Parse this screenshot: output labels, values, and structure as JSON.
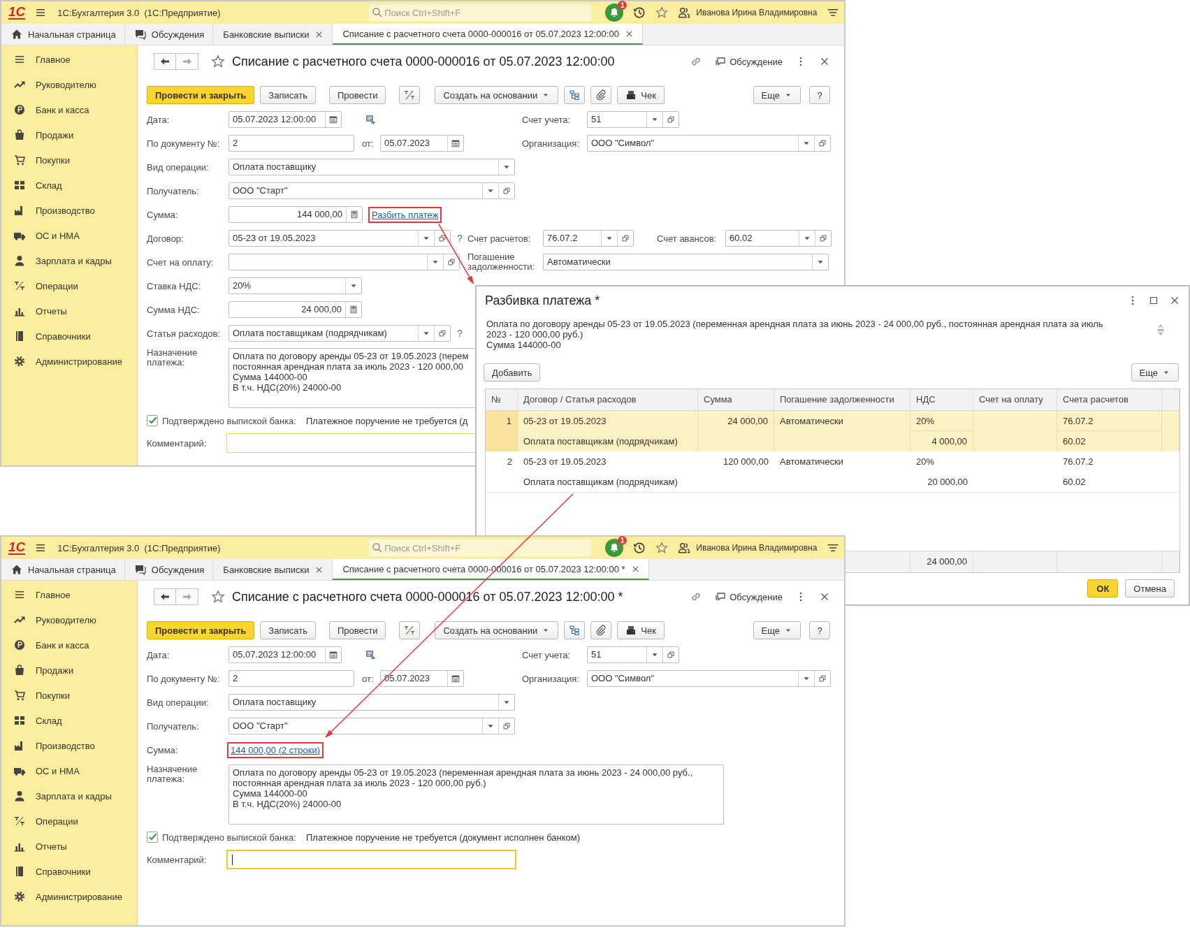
{
  "windows": [
    {
      "logo": "1С",
      "app_title": "1С:Бухгалтерия 3.0  (1С:Предприятие)",
      "search": {
        "placeholder": "Поиск Ctrl+Shift+F"
      },
      "notifications": "1",
      "user": "Иванова Ирина Владимировна",
      "tabs": [
        {
          "label": "Начальная страница",
          "selected": false,
          "kind": "home"
        },
        {
          "label": "Обсуждения",
          "selected": false,
          "kind": "chat"
        },
        {
          "label": "Банковские выписки",
          "selected": false,
          "kind": "doc"
        },
        {
          "label": "Списание с расчетного счета 0000-000016 от 05.07.2023 12:00:00",
          "selected": true,
          "kind": "doc"
        }
      ],
      "sidebar": [
        "Главное",
        "Руководителю",
        "Банк и касса",
        "Продажи",
        "Покупки",
        "Склад",
        "Производство",
        "ОС и НМА",
        "Зарплата и кадры",
        "Операции",
        "Отчеты",
        "Справочники",
        "Администрирование"
      ],
      "title": "Списание с расчетного счета 0000-000016 от 05.07.2023 12:00:00",
      "discussion": "Обсуждение",
      "toolbar": [
        {
          "kind": "primary",
          "label": "Провести и закрыть"
        },
        {
          "kind": "plain",
          "label": "Записать"
        },
        {
          "kind": "plain",
          "label": "Провести"
        },
        {
          "kind": "dtkt"
        },
        {
          "kind": "dropdown",
          "label": "Создать на основании"
        },
        {
          "kind": "structure"
        },
        {
          "kind": "clip"
        },
        {
          "kind": "receipt",
          "label": "Чек"
        }
      ],
      "toolbar_right": [
        {
          "kind": "dropdown",
          "label": "Еще"
        },
        {
          "kind": "plain",
          "label": "?"
        }
      ],
      "form": {
        "date": {
          "label": "Дата:",
          "value": "05.07.2023 12:00:00"
        },
        "number": {
          "label": "По документу №:",
          "value": "2"
        },
        "number_date": {
          "label": "от:",
          "value": "05.07.2023"
        },
        "account": {
          "label": "Счет учета:",
          "value": "51"
        },
        "organization": {
          "label": "Организация:",
          "value": "ООО \"Символ\""
        },
        "operation": {
          "label": "Вид операции:",
          "value": "Оплата поставщику"
        },
        "recipient": {
          "label": "Получатель:",
          "value": "ООО \"Старт\""
        },
        "amount": {
          "label": "Сумма:",
          "value": "144 000,00",
          "link": "Разбить платеж",
          "highlighted": true
        },
        "contract": {
          "label": "Договор:",
          "value": "05-23 от 19.05.2023",
          "help": "?"
        },
        "settlement_account": {
          "label": "Счет расчетов:",
          "value": "76.07.2"
        },
        "advance_account": {
          "label": "Счет авансов:",
          "value": "60.02"
        },
        "invoice": {
          "label": "Счет на оплату:"
        },
        "repayment": {
          "label": "Погашение задолженности:",
          "value": "Автоматически"
        },
        "vat_rate": {
          "label": "Ставка НДС:",
          "value": "20%"
        },
        "vat_amount": {
          "label": "Сумма НДС:",
          "value": "24 000,00"
        },
        "expense_item": {
          "label": "Статья расходов:",
          "value": "Оплата поставщикам (подрядчикам)",
          "help": "?"
        },
        "purpose": {
          "label": "Назначение платежа:",
          "text": "Оплата по договору аренды 05-23 от 19.05.2023 (перем\nпостоянная арендная плата за июль 2023 - 120 000,00\nСумма 144000-00\nВ т.ч. НДС(20%) 24000-00"
        },
        "confirmed": {
          "label": "Подтверждено выпиской банка:",
          "checked": true
        },
        "payment_order_note": "Платежное поручение не требуется (д",
        "comment": {
          "label": "Комментарий:",
          "focused": false
        }
      }
    },
    {
      "logo": "1С",
      "app_title": "1С:Бухгалтерия 3.0  (1С:Предприятие)",
      "search": {
        "placeholder": "Поиск Ctrl+Shift+F"
      },
      "notifications": "1",
      "user": "Иванова Ирина Владимировна",
      "tabs": [
        {
          "label": "Начальная страница",
          "selected": false,
          "kind": "home"
        },
        {
          "label": "Обсуждения",
          "selected": false,
          "kind": "chat"
        },
        {
          "label": "Банковские выписки",
          "selected": false,
          "kind": "doc"
        },
        {
          "label": "Списание с расчетного счета 0000-000016 от 05.07.2023 12:00:00 *",
          "selected": true,
          "kind": "doc"
        }
      ],
      "sidebar": [
        "Главное",
        "Руководителю",
        "Банк и касса",
        "Продажи",
        "Покупки",
        "Склад",
        "Производство",
        "ОС и НМА",
        "Зарплата и кадры",
        "Операции",
        "Отчеты",
        "Справочники",
        "Администрирование"
      ],
      "title": "Списание с расчетного счета 0000-000016 от 05.07.2023 12:00:00 *",
      "discussion": "Обсуждение",
      "toolbar": [
        {
          "kind": "primary",
          "label": "Провести и закрыть"
        },
        {
          "kind": "plain",
          "label": "Записать"
        },
        {
          "kind": "plain",
          "label": "Провести"
        },
        {
          "kind": "dtkt"
        },
        {
          "kind": "dropdown",
          "label": "Создать на основании"
        },
        {
          "kind": "structure"
        },
        {
          "kind": "clip"
        },
        {
          "kind": "receipt",
          "label": "Чек"
        }
      ],
      "toolbar_right": [
        {
          "kind": "dropdown",
          "label": "Еще"
        },
        {
          "kind": "plain",
          "label": "?"
        }
      ],
      "form": {
        "date": {
          "label": "Дата:",
          "value": "05.07.2023 12:00:00"
        },
        "number": {
          "label": "По документу №:",
          "value": "2"
        },
        "number_date": {
          "label": "от:",
          "value": "05.07.2023"
        },
        "account": {
          "label": "Счет учета:",
          "value": "51"
        },
        "organization": {
          "label": "Организация:",
          "value": "ООО \"Символ\""
        },
        "operation": {
          "label": "Вид операции:",
          "value": "Оплата поставщику"
        },
        "recipient": {
          "label": "Получатель:",
          "value": "ООО \"Старт\""
        },
        "amount": {
          "label": "Сумма:",
          "link": "144 000,00 (2 строки)",
          "highlighted": true
        },
        "purpose": {
          "label": "Назначение платежа:",
          "text": "Оплата по договору аренды 05-23 от 19.05.2023 (переменная арендная плата за июнь 2023 - 24 000,00 руб.,\nпостоянная арендная плата за июль 2023 - 120 000,00 руб.)\nСумма 144000-00\nВ т.ч. НДС(20%) 24000-00"
        },
        "confirmed": {
          "label": "Подтверждено выпиской банка:",
          "checked": true
        },
        "payment_order_note": "Платежное поручение не требуется (документ исполнен банком)",
        "comment": {
          "label": "Комментарий:",
          "focused": true
        }
      }
    }
  ],
  "dialog": {
    "title": "Разбивка платежа *",
    "description": "Оплата по договору аренды 05-23 от 19.05.2023 (переменная арендная плата за июнь 2023 - 24 000,00 руб., постоянная арендная плата за июль 2023 - 120 000,00 руб.)\nСумма 144000-00",
    "add_button": "Добавить",
    "more_button": "Еще",
    "columns": [
      "№",
      "Договор / Статья расходов",
      "Сумма",
      "Погашение задолженности",
      "НДС",
      "Счет на оплату",
      "Счета расчетов"
    ],
    "rows": [
      {
        "number": "1",
        "contract": "05-23 от 19.05.2023",
        "expense_item": "Оплата поставщикам (подрядчикам)",
        "amount": "24 000,00",
        "repayment": "Автоматически",
        "vat_rate": "20%",
        "vat_amount": "4 000,00",
        "settlement_account": "76.07.2",
        "advance_account": "60.02",
        "selected": true
      },
      {
        "number": "2",
        "contract": "05-23 от 19.05.2023",
        "expense_item": "Оплата поставщикам (подрядчикам)",
        "amount": "120 000,00",
        "repayment": "Автоматически",
        "vat_rate": "20%",
        "vat_amount": "20 000,00",
        "settlement_account": "76.07.2",
        "advance_account": "60.02",
        "selected": false
      }
    ],
    "total_vat": "24 000,00",
    "ok_button": "ОК",
    "cancel_button": "Отмена"
  }
}
